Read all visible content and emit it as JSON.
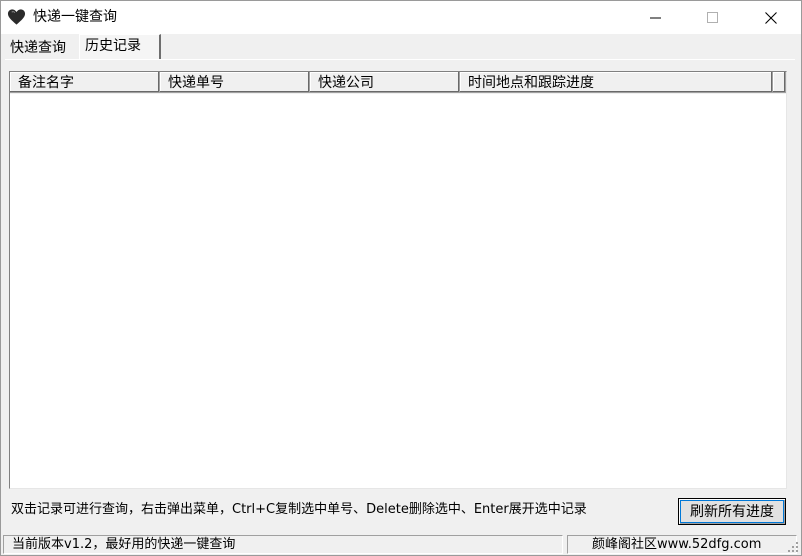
{
  "window": {
    "title": "快递一键查询",
    "icon": "heart-icon",
    "icon_color": "#2b2b2b"
  },
  "tabs": [
    {
      "label": "快递查询",
      "selected": false
    },
    {
      "label": "历史记录",
      "selected": true
    }
  ],
  "list": {
    "columns": [
      "备注名字",
      "快递单号",
      "快递公司",
      "时间地点和跟踪进度"
    ],
    "rows": []
  },
  "hint": "双击记录可进行查询，右击弹出菜单，Ctrl+C复制选中单号、Delete删除选中、Enter展开选中记录",
  "refresh_button": "刷新所有进度",
  "status": {
    "version_text": "当前版本v1.2，最好用的快递一键查询",
    "site_text": "颜峰阁社区www.52dfg.com"
  },
  "colors": {
    "focus": "#0078d7",
    "window_bg": "#f0f0f0"
  }
}
